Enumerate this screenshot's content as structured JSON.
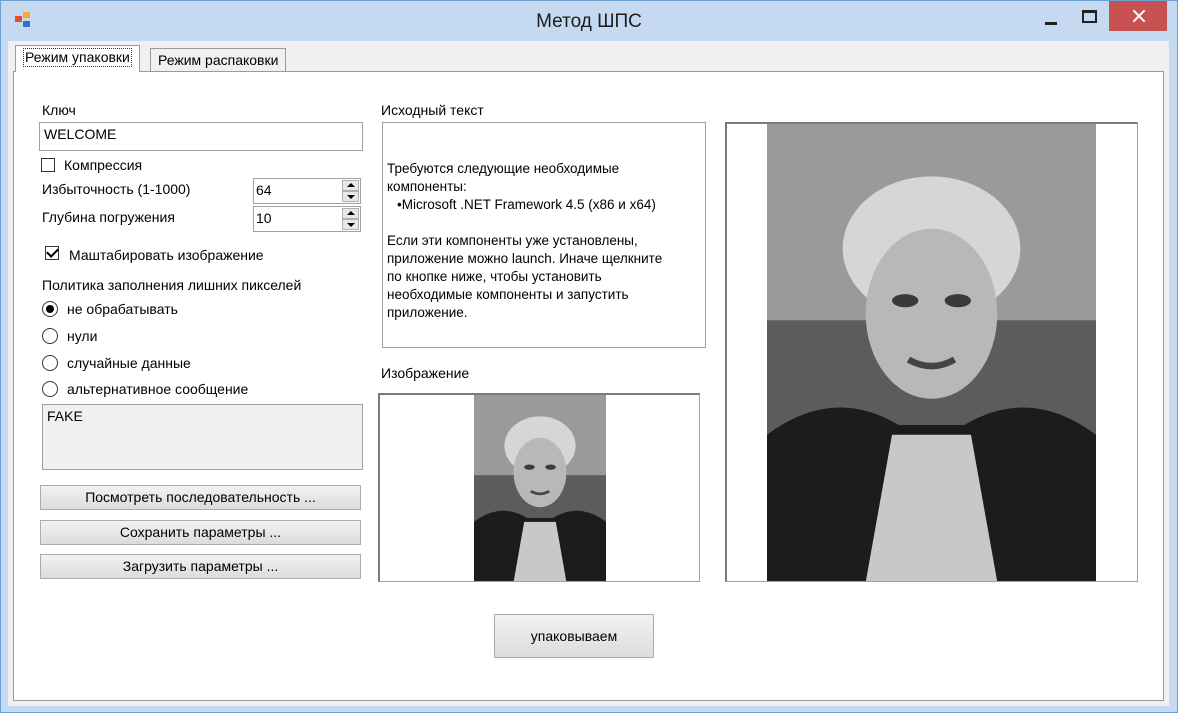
{
  "window": {
    "title": "Метод ШПС"
  },
  "tabs": [
    {
      "label": "Режим упаковки",
      "active": true
    },
    {
      "label": "Режим распаковки",
      "active": false
    }
  ],
  "form": {
    "key_label": "Ключ",
    "key_value": "WELCOME",
    "compression_label": "Компрессия",
    "compression_checked": false,
    "redundancy_label": "Избыточность (1-1000)",
    "redundancy_value": "64",
    "depth_label": "Глубина погружения",
    "depth_value": "10",
    "scale_label": "Маштабировать изображение",
    "scale_checked": true,
    "policy_label": "Политика заполнения лишних  пикселей",
    "policy_options": [
      {
        "label": "не обрабатывать",
        "selected": true
      },
      {
        "label": "нули",
        "selected": false
      },
      {
        "label": "случайные данные",
        "selected": false
      },
      {
        "label": "альтернативное сообщение",
        "selected": false
      }
    ],
    "alt_message": "FAKE",
    "buttons": {
      "view_sequence": "Посмотреть последовательность ...",
      "save_params": "Сохранить параметры ...",
      "load_params": "Загрузить параметры ..."
    }
  },
  "source_text": {
    "label": "Исходный текст",
    "lines": [
      "Требуются следующие необходимые",
      "компоненты:",
      "•Microsoft .NET Framework 4.5 (x86 и x64)",
      "",
      "Если эти компоненты уже установлены,",
      "приложение можно launch. Иначе щелкните",
      "по кнопке ниже, чтобы установить",
      "необходимые компоненты и запустить",
      "приложение."
    ]
  },
  "image_section": {
    "label": "Изображение"
  },
  "pack_button": "упаковываем",
  "colors": {
    "titlebar": "#c5daf1",
    "close_button": "#c75050",
    "panel": "#ffffff",
    "form_bg": "#f0f0f0"
  }
}
